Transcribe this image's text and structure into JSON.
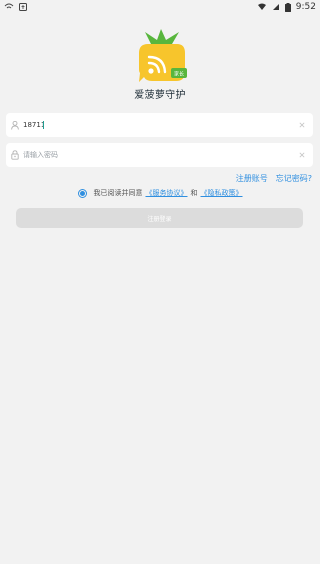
{
  "status_bar": {
    "time": "9:52",
    "left_icons": [
      "wifi-alert-icon",
      "notification-icon"
    ],
    "right_icons": [
      "wifi-icon",
      "signal-icon",
      "battery-icon"
    ]
  },
  "app": {
    "name": "爱菠萝守护",
    "logo_badge": "家长"
  },
  "login_form": {
    "phone_value": "18711",
    "password_placeholder": "请输入密码",
    "register_link": "注册账号",
    "forgot_link": "忘记密码?",
    "agreement_prefix": "我已阅读并同意",
    "service_policy": "《服务协议》",
    "and": "和",
    "privacy_policy": "《隐私政策》",
    "agreement_checked": true,
    "login_button": "注册登录"
  },
  "colors": {
    "accent_blue": "#2f8fe0",
    "logo_yellow": "#f7c52c",
    "logo_green": "#58b63d",
    "background": "#f2f2f2"
  }
}
